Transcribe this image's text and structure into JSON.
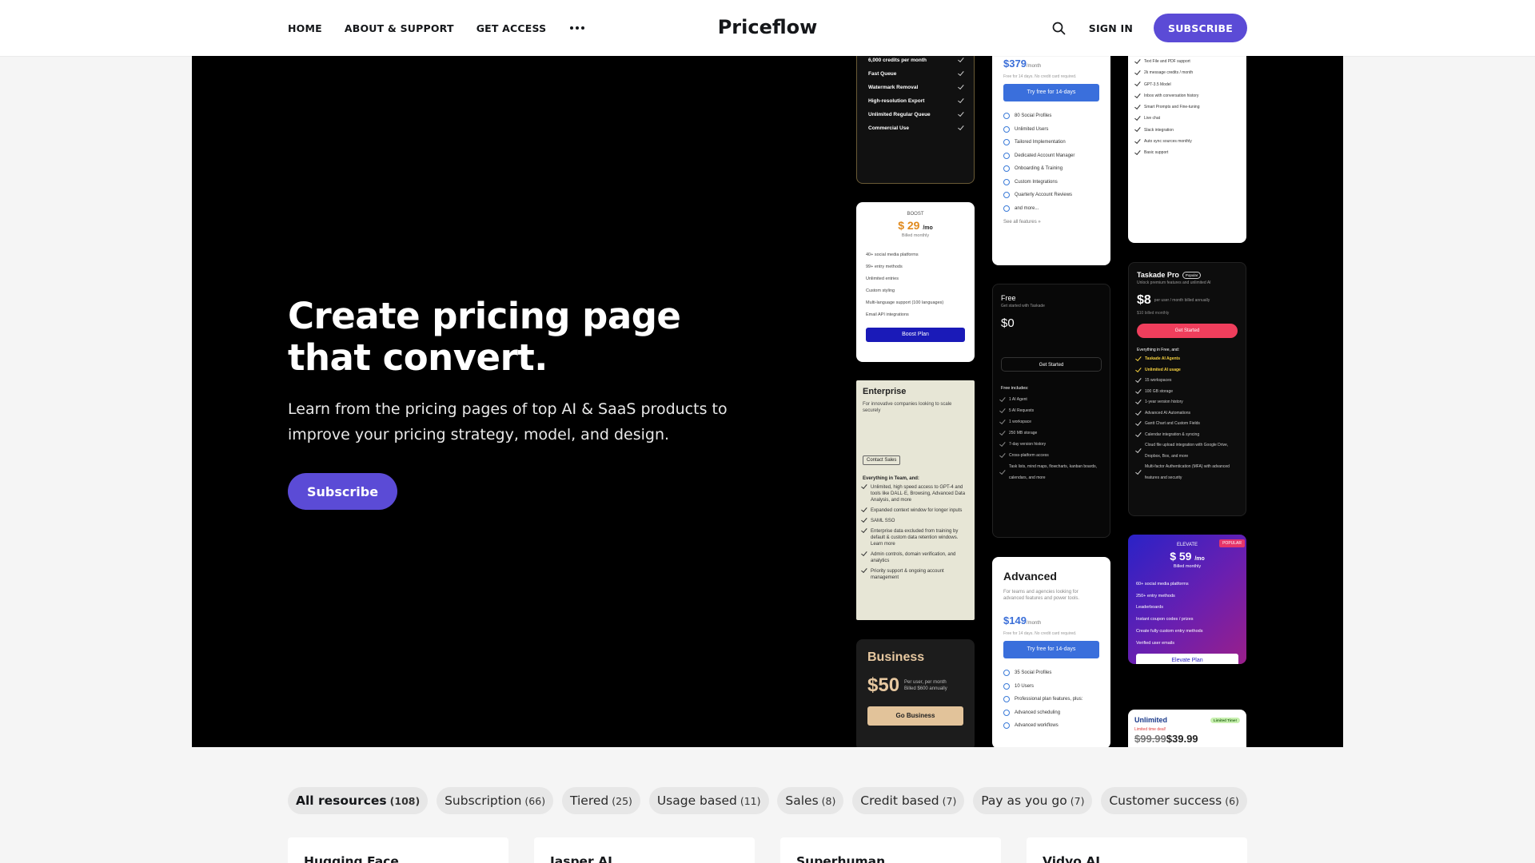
{
  "nav": {
    "links": [
      "HOME",
      "ABOUT & SUPPORT",
      "GET ACCESS"
    ],
    "more_icon": "more-dots-icon",
    "logo": "Priceflow",
    "search_icon": "search-icon",
    "sign_in": "SIGN IN",
    "subscribe": "SUBSCRIBE"
  },
  "hero": {
    "title": "Create pricing page that convert.",
    "subtitle": "Learn from the pricing pages of top AI & SaaS products to improve your pricing strategy, model, and design.",
    "cta": "Subscribe"
  },
  "thumbs": {
    "c1": {
      "features": [
        "6,000 credits per month",
        "Fast Queue",
        "Watermark Removal",
        "High-resolution Export",
        "Unlimited Regular Queue",
        "Commercial Use"
      ]
    },
    "c2": {
      "tier": "BOOST",
      "price": "$ 29",
      "unit": "/mo",
      "billed": "Billed monthly",
      "features": [
        "40+ social media platforms",
        "99+ entry methods",
        "Unlimited entries",
        "Custom styling",
        "Multi-language support (100 languages)",
        "Email API integrations"
      ],
      "button": "Boost Plan"
    },
    "c3": {
      "title": "Enterprise",
      "desc": "For innovative companies looking to scale securely",
      "contact": "Contact Sales",
      "heading": "Everything in Team, and:",
      "features": [
        "Unlimited, high speed access to GPT-4 and tools like DALL·E, Browsing, Advanced Data Analysis, and more",
        "Expanded context window for longer inputs",
        "SAML SSO",
        "Enterprise data excluded from training by default & custom data retention windows. Learn more",
        "Admin controls, domain verification, and analytics",
        "Priority support & ongoing account management"
      ]
    },
    "c4": {
      "title": "Business",
      "price": "$50",
      "per": "Per user, per month",
      "billed": "Billed $600 annually",
      "button": "Go Business"
    },
    "c5": {
      "price": "$379",
      "unit": "/month",
      "note": "Free for 14 days. No credit card required.",
      "button": "Try free for 14-days",
      "features": [
        "80 Social Profiles",
        "Unlimited Users",
        "Tailored Implementation",
        "Dedicated Account Manager",
        "Onboarding & Training",
        "Custom Integrations",
        "Quarterly Account Reviews",
        "and more..."
      ],
      "see_all": "See all features »"
    },
    "c6": {
      "title": "Free",
      "sub": "Get started with Taskade",
      "price": "$0",
      "button": "Get Started",
      "heading": "Free includes:",
      "features": [
        "1 AI Agent",
        "5 AI Requests",
        "1 workspace",
        "250 MB storage",
        "7-day version history",
        "Cross-platform access",
        "Task lists, mind maps, flowcharts, kanban boards, calendars, and more"
      ]
    },
    "c7": {
      "title": "Advanced",
      "desc": "For teams and agencies looking for advanced features and power tools.",
      "price": "$149",
      "unit": "/month",
      "note": "Free for 14 days. No credit card required.",
      "button": "Try free for 14-days",
      "features": [
        "35 Social Profiles",
        "10 Users",
        "Professional plan features, plus:",
        "Advanced scheduling",
        "Advanced workflows"
      ]
    },
    "c8": {
      "features": [
        "Text File and PDF support",
        "2k message credits / month",
        "GPT-3.5 Model",
        "Inbox with conversation history",
        "Smart Prompts and Fine-tuning",
        "Live chat",
        "Slack integration",
        "Auto sync sources monthly",
        "Basic support"
      ]
    },
    "c9": {
      "title": "Taskade Pro",
      "badge": "Popular",
      "sub": "Unlock premium features and unlimited AI",
      "price": "$8",
      "per": "per user / month billed annually",
      "billed": "$10 billed monthly",
      "button": "Get Started",
      "heading": "Everything in Free, and:",
      "features": [
        "Taskade AI Agents",
        "Unlimited AI usage",
        "15 workspaces",
        "100 GB storage",
        "1-year version history",
        "Advanced AI Automations",
        "Gantt Chart and Custom Fields",
        "Calendar integration & syncing",
        "Cloud file upload integration with Google Drive, Dropbox, Box, and more",
        "Multi-factor Authentication (MFA) with advanced features and security"
      ]
    },
    "c10": {
      "badge": "POPULAR",
      "tier": "ELEVATE",
      "price": "$ 59",
      "unit": "/mo",
      "billed": "Billed monthly",
      "features": [
        "60+ social media platforms",
        "250+ entry methods",
        "Leaderboards",
        "Instant coupon codes / prizes",
        "Create fully custom entry methods",
        "Verified user emails"
      ],
      "button": "Elevate Plan"
    },
    "c11": {
      "title": "Unlimited",
      "badge": "Limited Time!",
      "deal": "Limited time deal!",
      "old_price": "$99.99",
      "price": "$39.99"
    }
  },
  "filters": [
    {
      "label": "All resources",
      "count": "(108)"
    },
    {
      "label": "Subscription",
      "count": "(66)"
    },
    {
      "label": "Tiered",
      "count": "(25)"
    },
    {
      "label": "Usage based",
      "count": "(11)"
    },
    {
      "label": "Sales",
      "count": "(8)"
    },
    {
      "label": "Credit based",
      "count": "(7)"
    },
    {
      "label": "Pay as you go",
      "count": "(7)"
    },
    {
      "label": "Customer success",
      "count": "(6)"
    }
  ],
  "resources": [
    "Hugging Face",
    "Jasper AI",
    "Superhuman",
    "Vidyo AI"
  ]
}
